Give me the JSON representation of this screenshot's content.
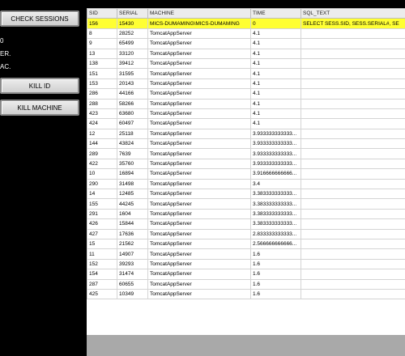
{
  "buttons": {
    "check_sessions": "CHECK SESSIONS",
    "kill_id": "KILL ID",
    "kill_machine": "KILL MACHINE"
  },
  "labels": {
    "l1": "0",
    "l2": "ER.",
    "l3": "AC."
  },
  "grid": {
    "columns": [
      "SID",
      "SERIAL",
      "MACHINE",
      "TIME",
      "SQL_TEXT"
    ],
    "rows": [
      [
        "156",
        "15430",
        "MICS-DUMAMING\\MICS-DUMAMING",
        "0",
        "SELECT SESS.SID, SESS.SERIAL#, SE"
      ],
      [
        "8",
        "28252",
        "TomcatAppServer",
        "4.1",
        ""
      ],
      [
        "9",
        "65499",
        "TomcatAppServer",
        "4.1",
        ""
      ],
      [
        "13",
        "33120",
        "TomcatAppServer",
        "4.1",
        ""
      ],
      [
        "138",
        "39412",
        "TomcatAppServer",
        "4.1",
        ""
      ],
      [
        "151",
        "31595",
        "TomcatAppServer",
        "4.1",
        ""
      ],
      [
        "153",
        "20143",
        "TomcatAppServer",
        "4.1",
        ""
      ],
      [
        "286",
        "44166",
        "TomcatAppServer",
        "4.1",
        ""
      ],
      [
        "288",
        "58266",
        "TomcatAppServer",
        "4.1",
        ""
      ],
      [
        "423",
        "63680",
        "TomcatAppServer",
        "4.1",
        ""
      ],
      [
        "424",
        "60497",
        "TomcatAppServer",
        "4.1",
        ""
      ],
      [
        "12",
        "25118",
        "TomcatAppServer",
        "3.933333333333...",
        ""
      ],
      [
        "144",
        "43824",
        "TomcatAppServer",
        "3.933333333333...",
        ""
      ],
      [
        "289",
        "7639",
        "TomcatAppServer",
        "3.933333333333...",
        ""
      ],
      [
        "422",
        "35760",
        "TomcatAppServer",
        "3.933333333333...",
        ""
      ],
      [
        "10",
        "16894",
        "TomcatAppServer",
        "3.916666666666...",
        ""
      ],
      [
        "290",
        "31498",
        "TomcatAppServer",
        "3.4",
        ""
      ],
      [
        "14",
        "12485",
        "TomcatAppServer",
        "3.383333333333...",
        ""
      ],
      [
        "155",
        "44245",
        "TomcatAppServer",
        "3.383333333333...",
        ""
      ],
      [
        "291",
        "1604",
        "TomcatAppServer",
        "3.383333333333...",
        ""
      ],
      [
        "426",
        "15844",
        "TomcatAppServer",
        "3.383333333333...",
        ""
      ],
      [
        "427",
        "17636",
        "TomcatAppServer",
        "2.833333333333...",
        ""
      ],
      [
        "15",
        "21562",
        "TomcatAppServer",
        "2.566666666666...",
        ""
      ],
      [
        "11",
        "14907",
        "TomcatAppServer",
        "1.6",
        ""
      ],
      [
        "152",
        "39293",
        "TomcatAppServer",
        "1.6",
        ""
      ],
      [
        "154",
        "31474",
        "TomcatAppServer",
        "1.6",
        ""
      ],
      [
        "287",
        "60655",
        "TomcatAppServer",
        "1.6",
        ""
      ],
      [
        "425",
        "10349",
        "TomcatAppServer",
        "1.6",
        ""
      ]
    ],
    "selected_row": 0
  },
  "colors": {
    "selected_row": "#ffff33",
    "background": "#000000",
    "empty_area": "#a9a9a9"
  }
}
